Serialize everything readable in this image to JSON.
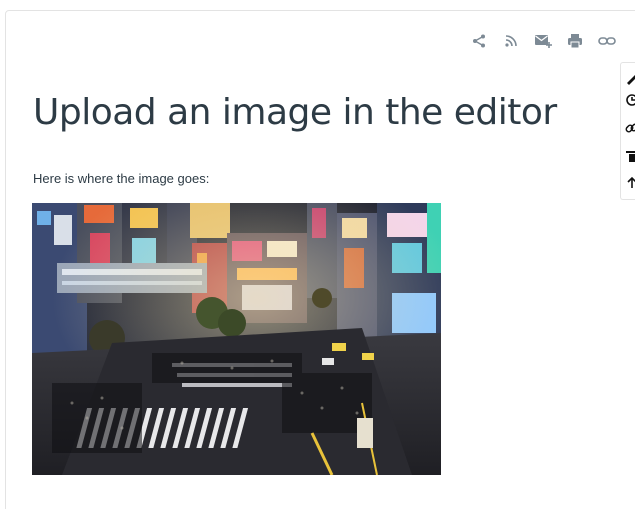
{
  "toolbar": {
    "icons": [
      "share-icon",
      "rss-icon",
      "email-add-icon",
      "print-icon",
      "link-icon"
    ],
    "icon_color": "#7d8a95"
  },
  "article": {
    "title": "Upload an image in the editor",
    "body": "Here is where the image goes:"
  },
  "image": {
    "alt": "Shibuya crossing at night",
    "subject": "city-crossing-photo"
  },
  "side_tools": {
    "icons": [
      "edit-icon",
      "history-icon",
      "link-icon",
      "delete-icon",
      "up-arrow-icon"
    ]
  },
  "colors": {
    "text": "#2d3b45",
    "border": "#e3e3e3"
  }
}
